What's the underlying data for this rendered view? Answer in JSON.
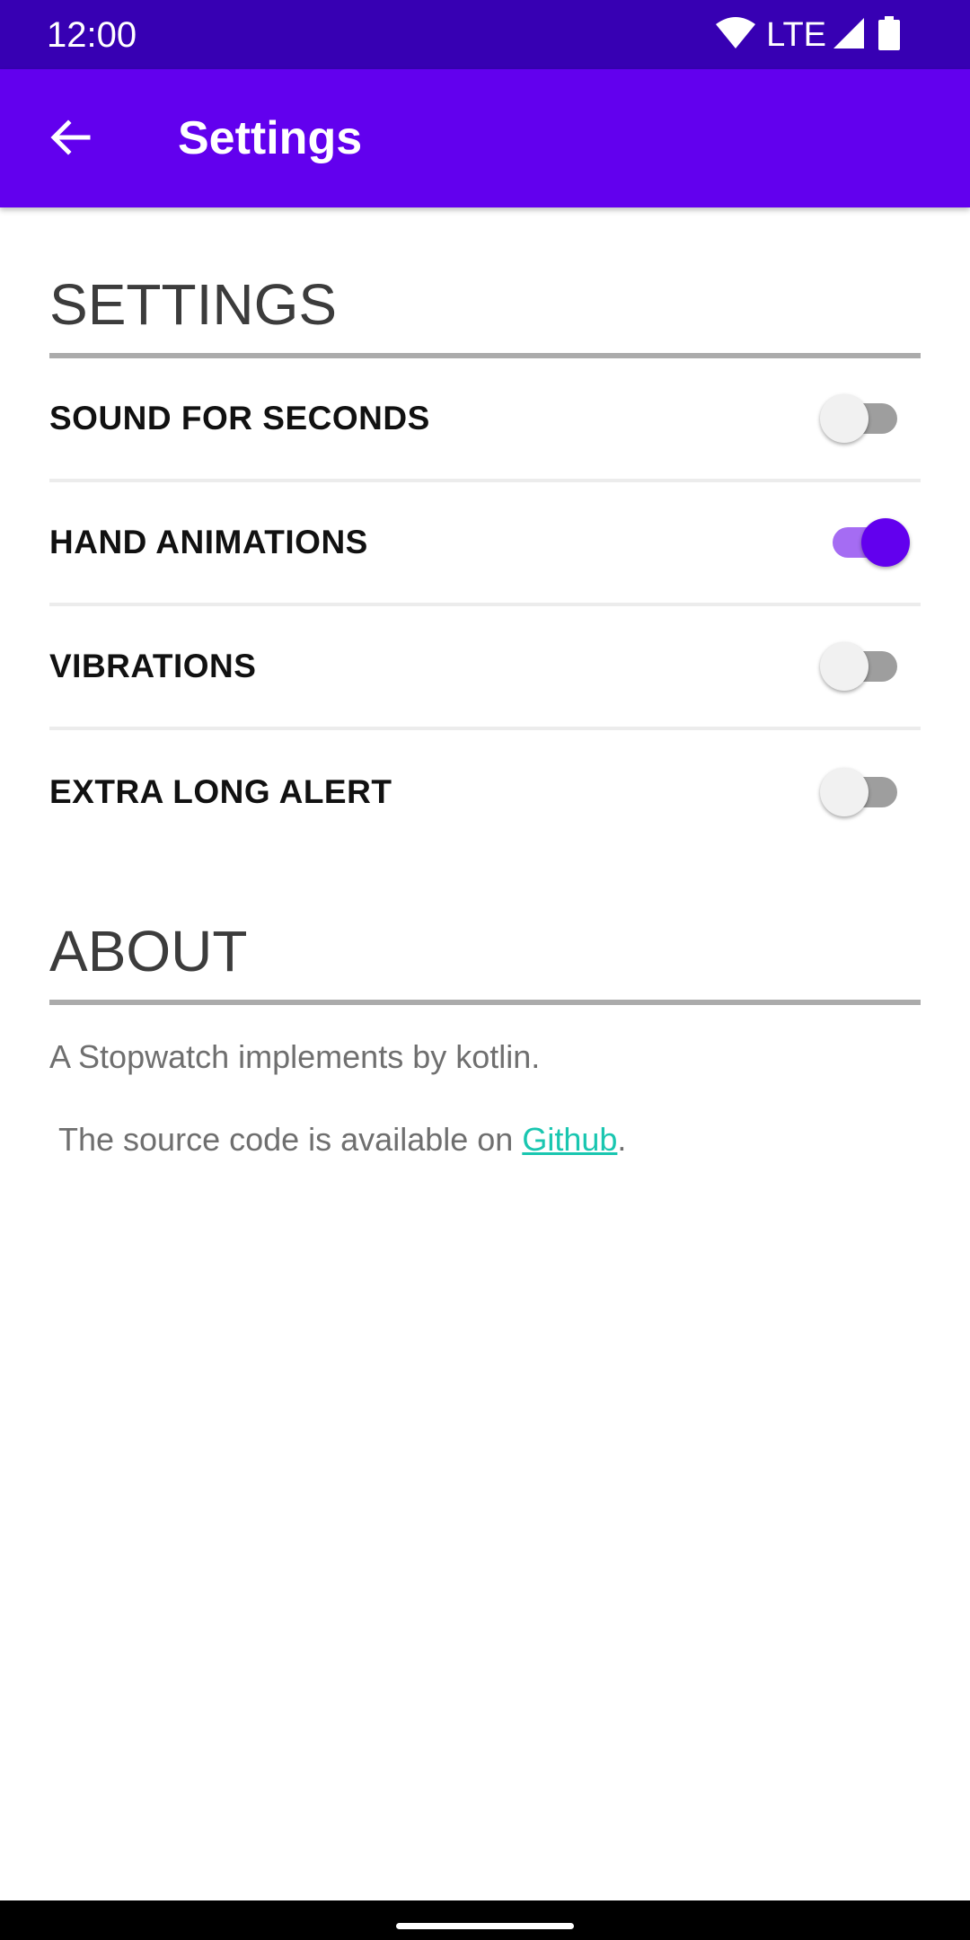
{
  "status_bar": {
    "time": "12:00",
    "network": "LTE",
    "icons": [
      "wifi-icon",
      "signal-icon",
      "battery-icon"
    ]
  },
  "app_bar": {
    "title": "Settings",
    "back_icon": "arrow-left-icon",
    "color": "#6200ee"
  },
  "settings_section": {
    "header": "SETTINGS",
    "items": [
      {
        "label": "SOUND FOR SECONDS",
        "enabled": false
      },
      {
        "label": "HAND ANIMATIONS",
        "enabled": true
      },
      {
        "label": "VIBRATIONS",
        "enabled": false
      },
      {
        "label": "EXTRA LONG ALERT",
        "enabled": false
      }
    ]
  },
  "about_section": {
    "header": "ABOUT",
    "line1": "A Stopwatch implements by kotlin.",
    "line2_prefix": "The source code is available on ",
    "link_text": "Github",
    "line2_suffix": "."
  },
  "colors": {
    "status_bar": "#3700b3",
    "accent": "#6200ee",
    "link": "#19c6b0"
  }
}
